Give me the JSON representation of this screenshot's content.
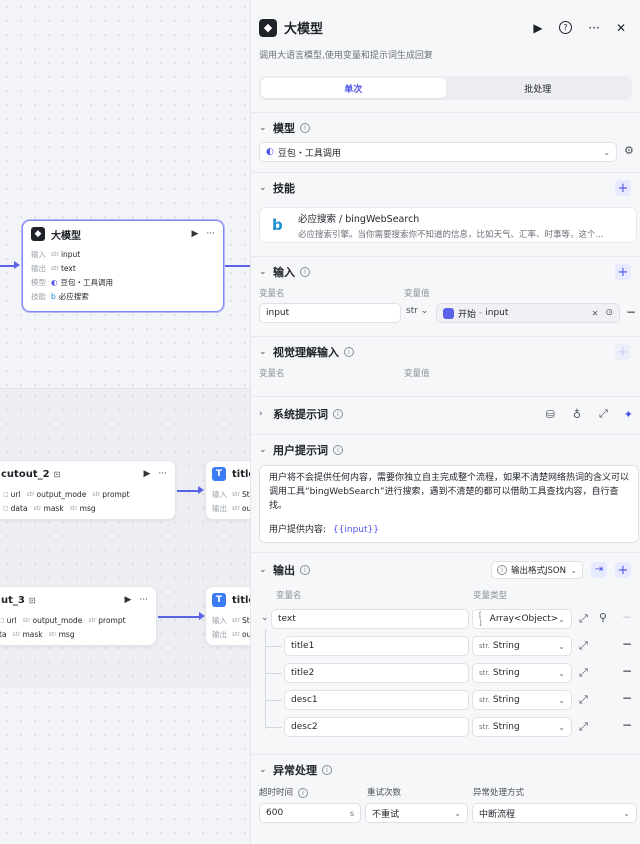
{
  "canvas": {
    "llm_node": {
      "title": "大模型",
      "rows": [
        {
          "key": "输入",
          "type": "str",
          "value": "input"
        },
        {
          "key": "输出",
          "type": "str",
          "value": "text"
        },
        {
          "key": "模型",
          "value": "豆包・工具调用"
        },
        {
          "key": "技能",
          "value": "必应搜索"
        }
      ]
    },
    "cutout2": {
      "title": "cutout_2",
      "row1": [
        "url",
        "output_mode",
        "prompt"
      ],
      "row2": [
        "data",
        "mask",
        "msg"
      ]
    },
    "cutout3": {
      "title": "ut_3",
      "row1": [
        "url",
        "output_mode",
        "prompt"
      ],
      "row2": [
        "ta",
        "mask",
        "msg"
      ]
    },
    "title_node_a": {
      "title": "title",
      "r1k": "输入",
      "r1v": "Str",
      "r2k": "输出",
      "r2v": "ou"
    },
    "title_node_b": {
      "title": "title",
      "r1k": "输入",
      "r1v": "Str",
      "r2k": "输出",
      "r2v": "ou"
    }
  },
  "panel": {
    "title": "大模型",
    "description": "调用大语言模型,使用变量和提示词生成回复",
    "tabs": [
      {
        "label": "单次"
      },
      {
        "label": "批处理"
      }
    ],
    "model": {
      "title": "模型",
      "value": "豆包・工具调用"
    },
    "skills": {
      "title": "技能",
      "name": "必应搜索 / bingWebSearch",
      "desc": "必应搜索引擎。当你需要搜索你不知道的信息，比如天气、汇率、时事等，这个..."
    },
    "input": {
      "title": "输入",
      "col_name": "变量名",
      "col_value": "变量值",
      "var_name": "input",
      "type": "str",
      "ref_source": "开始",
      "ref_var": "input"
    },
    "vision": {
      "title": "视觉理解输入",
      "col_name": "变量名",
      "col_value": "变量值"
    },
    "system_prompt": {
      "title": "系统提示词"
    },
    "user_prompt": {
      "title": "用户提示词",
      "line1": "用户将不会提供任何内容，需要你独立自主完成整个流程，如果不清楚网络热词的含义可以调用工具“bingWebSearch”进行搜索，遇到不清楚的都可以借助工具查找内容，自行查找。",
      "line2_prefix": "用户提供内容:",
      "line2_var": "{{input}}"
    },
    "output": {
      "title": "输出",
      "format": "输出格式JSON",
      "col_name": "变量名",
      "col_type": "变量类型",
      "root": {
        "name": "text",
        "type": "Array<Object>",
        "type_prefix": "[ ]"
      },
      "children": [
        {
          "name": "title1",
          "type": "String",
          "type_prefix": "str."
        },
        {
          "name": "title2",
          "type": "String",
          "type_prefix": "str."
        },
        {
          "name": "desc1",
          "type": "String",
          "type_prefix": "str."
        },
        {
          "name": "desc2",
          "type": "String",
          "type_prefix": "str."
        }
      ]
    },
    "error": {
      "title": "异常处理",
      "timeout_label": "超时时间",
      "retry_label": "重试次数",
      "mode_label": "异常处理方式",
      "timeout_value": "600",
      "timeout_unit": "s",
      "retry_value": "不重试",
      "mode_value": "中断流程"
    }
  }
}
